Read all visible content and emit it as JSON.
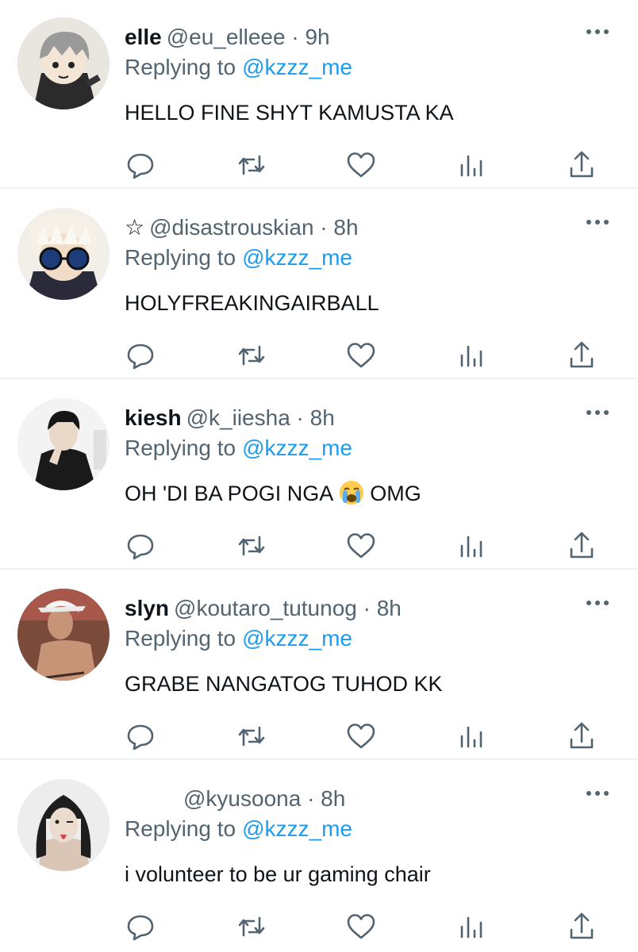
{
  "tweets": [
    {
      "name": "elle",
      "handle": "@eu_elleee",
      "time": "· 9h",
      "replying_label": "Replying to",
      "replying_to": "@kzzz_me",
      "text": "HELLO FINE SHYT KAMUSTA KA"
    },
    {
      "name": "☆",
      "handle": "@disastrouskian",
      "time": "· 8h",
      "replying_label": "Replying to",
      "replying_to": "@kzzz_me",
      "text": "HOLYFREAKINGAIRBALL"
    },
    {
      "name": "kiesh",
      "handle": "@k_iiesha",
      "time": "· 8h",
      "replying_label": "Replying to",
      "replying_to": "@kzzz_me",
      "text_before": "OH 'DI BA POGI NGA",
      "text_after": "OMG"
    },
    {
      "name": "slyn",
      "handle": "@koutaro_tutunog",
      "time": "· 8h",
      "replying_label": "Replying to",
      "replying_to": "@kzzz_me",
      "text": "GRABE NANGATOG TUHOD KK"
    },
    {
      "name": "",
      "handle": "@kyusoona",
      "time": "· 8h",
      "replying_label": "Replying to",
      "replying_to": "@kzzz_me",
      "text": "i volunteer to be ur gaming chair"
    }
  ],
  "icons": {
    "reply": "comment-icon",
    "retweet": "retweet-icon",
    "like": "heart-icon",
    "views": "analytics-icon",
    "share": "share-icon",
    "more": "more-dots-icon",
    "emoji": "loudly-crying-face-emoji"
  },
  "colors": {
    "text": "#0f1419",
    "secondary": "#536471",
    "link": "#1d9bf0",
    "divider": "#eff3f4"
  }
}
